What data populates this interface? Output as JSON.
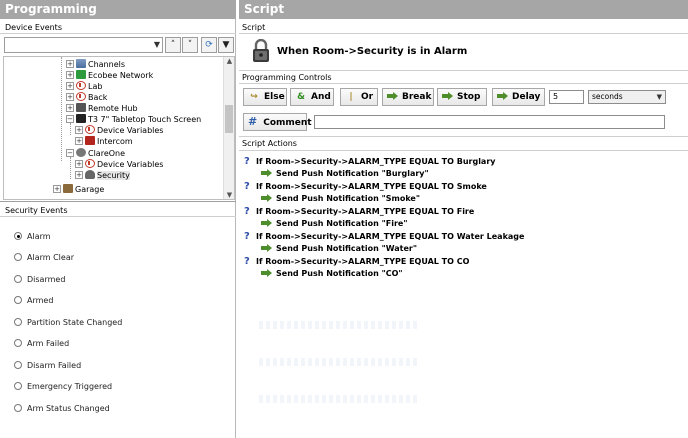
{
  "left": {
    "title": "Programming",
    "device_events_label": "Device Events",
    "tree": [
      {
        "label": "Channels",
        "icon": "channels-icon"
      },
      {
        "label": "Ecobee Network",
        "icon": "ecobee-icon"
      },
      {
        "label": "Lab",
        "icon": "control4-icon"
      },
      {
        "label": "Back",
        "icon": "control4-icon"
      },
      {
        "label": "Remote Hub",
        "icon": "hub-icon"
      },
      {
        "label": "T3 7\" Tabletop Touch Screen",
        "icon": "touchscreen-icon"
      },
      {
        "label": "Device Variables",
        "icon": "control4-icon"
      },
      {
        "label": "Intercom",
        "icon": "intercom-icon"
      },
      {
        "label": "ClareOne",
        "icon": "clareone-icon"
      },
      {
        "label": "Device Variables",
        "icon": "control4-icon"
      },
      {
        "label": "Security",
        "icon": "security-icon"
      },
      {
        "label": "Garage",
        "icon": "garage-icon"
      }
    ],
    "security_events_label": "Security Events",
    "events": [
      "Alarm",
      "Alarm Clear",
      "Disarmed",
      "Armed",
      "Partition State Changed",
      "Arm Failed",
      "Disarm Failed",
      "Emergency Triggered",
      "Arm Status Changed"
    ],
    "selected_event": "Alarm"
  },
  "right": {
    "title": "Script",
    "script_label": "Script",
    "script_title": "When Room->Security is in Alarm",
    "controls_label": "Programming Controls",
    "controls": {
      "else": "Else",
      "and": "And",
      "or": "Or",
      "break": "Break",
      "stop": "Stop",
      "delay": "Delay"
    },
    "delay_value": "5",
    "delay_unit": "seconds",
    "comment_label": "Comment",
    "actions_label": "Script Actions",
    "actions": [
      {
        "condition": "If Room->Security->ALARM_TYPE EQUAL TO Burglary",
        "action": "Send Push Notification \"Burglary\""
      },
      {
        "condition": "If Room->Security->ALARM_TYPE EQUAL TO Smoke",
        "action": "Send Push Notification \"Smoke\""
      },
      {
        "condition": "If Room->Security->ALARM_TYPE EQUAL TO Fire",
        "action": "Send Push Notification \"Fire\""
      },
      {
        "condition": "If Room->Security->ALARM_TYPE EQUAL TO Water Leakage",
        "action": "Send Push Notification \"Water\""
      },
      {
        "condition": "If Room->Security->ALARM_TYPE EQUAL TO CO",
        "action": "Send Push Notification \"CO\""
      }
    ]
  },
  "colors": {
    "title_bar": "#a6a6a6",
    "question_mark": "#2f4fa8",
    "action_arrow": "#4d8d2b"
  }
}
